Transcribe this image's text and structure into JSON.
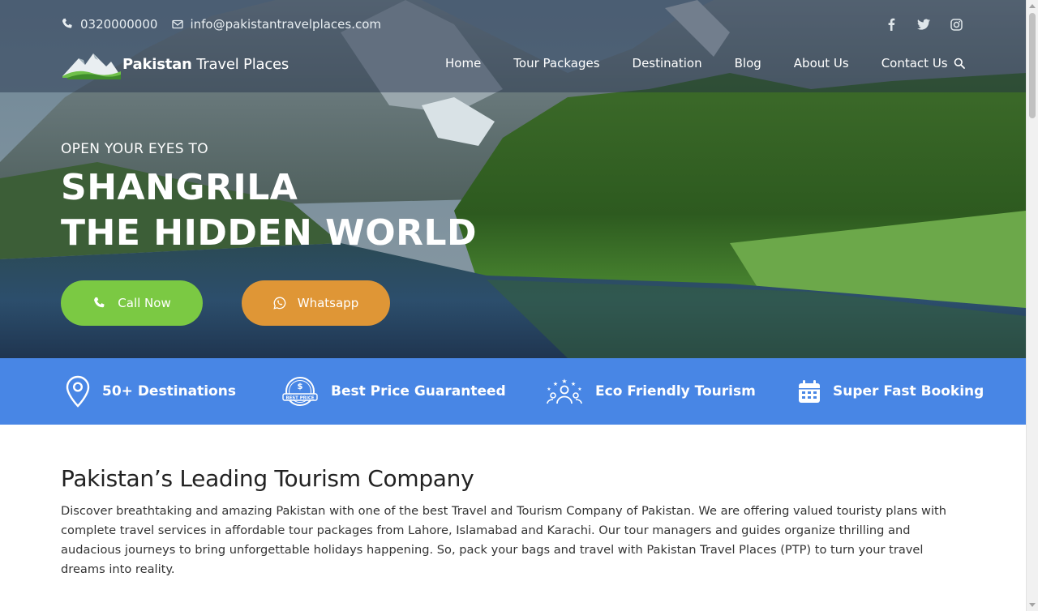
{
  "contact": {
    "phone": "0320000000",
    "email": "info@pakistantravelplaces.com"
  },
  "social": [
    "facebook-icon",
    "twitter-icon",
    "instagram-icon"
  ],
  "logo": {
    "bold": "Pakistan",
    "light": " Travel Places"
  },
  "nav": [
    "Home",
    "Tour Packages",
    "Destination",
    "Blog",
    "About Us",
    "Contact Us"
  ],
  "hero": {
    "tagline": "OPEN YOUR EYES TO",
    "title_line1": "SHANGRILA",
    "title_line2": "THE HIDDEN WORLD",
    "call_label": "Call Now",
    "whatsapp_label": "Whatsapp"
  },
  "features": [
    {
      "label": "50+ Destinations",
      "icon": "map-pin-icon"
    },
    {
      "label": "Best Price Guaranteed",
      "icon": "best-price-badge-icon"
    },
    {
      "label": "Eco Friendly Tourism",
      "icon": "people-stars-icon"
    },
    {
      "label": "Super Fast Booking",
      "icon": "calendar-icon"
    }
  ],
  "about": {
    "heading": "Pakistan’s Leading Tourism Company",
    "body": "Discover breathtaking and amazing Pakistan with one of the best Travel and Tourism Company of Pakistan. We are offering valued touristy plans with complete travel services in affordable tour packages from Lahore, Islamabad and Karachi. Our tour managers and guides organize thrilling and audacious journeys to bring unforgettable holidays happening. So, pack your bags and travel with Pakistan Travel Places (PTP) to turn your travel dreams into reality."
  },
  "colors": {
    "feature_bar": "#4886e5",
    "call_button": "#7bc943",
    "whatsapp_button": "#df9636"
  }
}
